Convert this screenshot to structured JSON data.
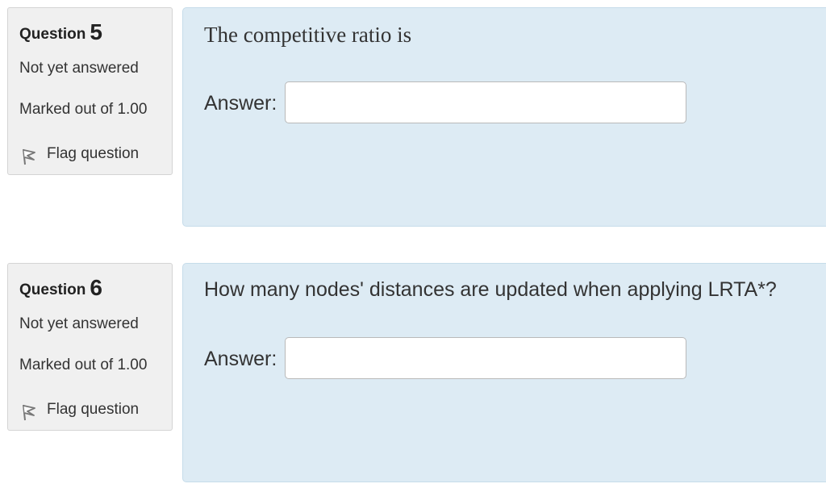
{
  "questions": [
    {
      "label": "Question",
      "number": "5",
      "state": "Not yet answered",
      "grade": "Marked out of 1.00",
      "flag_label": "Flag question",
      "text": "The competitive ratio is",
      "answer_label": "Answer:",
      "answer_value": ""
    },
    {
      "label": "Question",
      "number": "6",
      "state": "Not yet answered",
      "grade": "Marked out of 1.00",
      "flag_label": "Flag question",
      "text": "How many nodes' distances are updated when applying LRTA*?",
      "answer_label": "Answer:",
      "answer_value": ""
    }
  ],
  "icons": {
    "flag": "flag-icon"
  },
  "colors": {
    "info_bg": "#f0f0f0",
    "content_bg": "#ddebf4",
    "content_border": "#c6dcea",
    "text": "#333333"
  }
}
